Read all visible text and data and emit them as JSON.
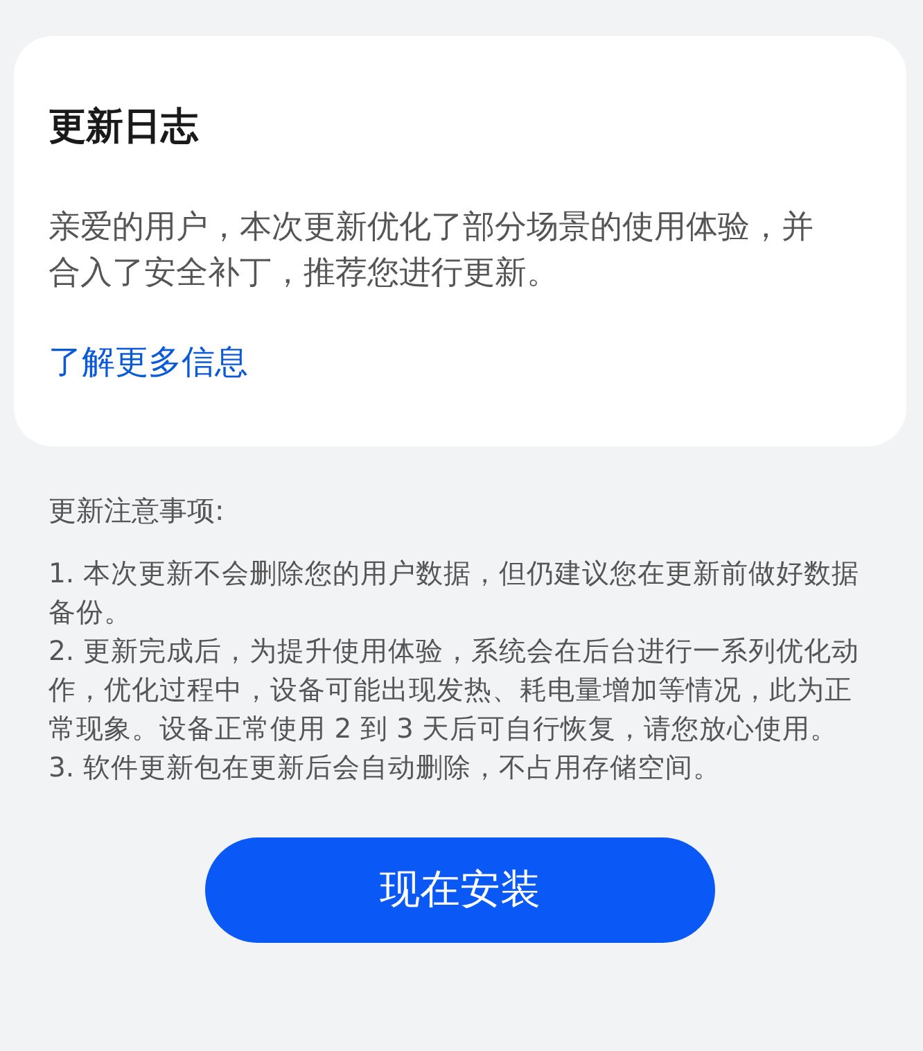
{
  "card": {
    "title": "更新日志",
    "description": "亲爱的用户，本次更新优化了部分场景的使用体验，并合入了安全补丁，推荐您进行更新。",
    "link": "了解更多信息"
  },
  "notes": {
    "heading": "更新注意事项:",
    "items": [
      "1. 本次更新不会删除您的用户数据，但仍建议您在更新前做好数据备份。",
      "2. 更新完成后，为提升使用体验，系统会在后台进行一系列优化动作，优化过程中，设备可能出现发热、耗电量增加等情况，此为正常现象。设备正常使用 2 到 3 天后可自行恢复，请您放心使用。",
      "3. 软件更新包在更新后会自动删除，不占用存储空间。"
    ]
  },
  "install_button": "现在安装"
}
